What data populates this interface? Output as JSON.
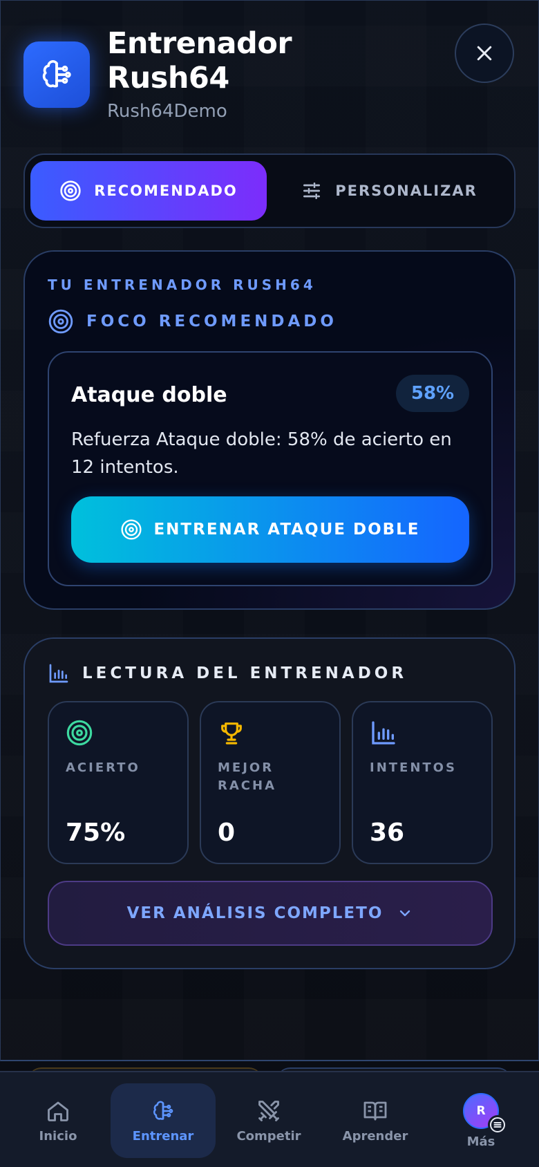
{
  "header": {
    "title_line1": "Entrenador",
    "title_line2": "Rush64",
    "subtitle": "Rush64Demo"
  },
  "icons": {
    "app": "brain-icon",
    "close": "close-icon",
    "recommended": "target-icon",
    "customize": "sliders-icon",
    "chart": "bar-chart-icon",
    "trophy": "trophy-icon",
    "chevron": "chevron-down-icon"
  },
  "tabs": [
    {
      "label": "RECOMENDADO",
      "active": true
    },
    {
      "label": "PERSONALIZAR",
      "active": false
    }
  ],
  "coach": {
    "eyebrow": "TU ENTRENADOR RUSH64",
    "focus_label": "FOCO RECOMENDADO",
    "focus": {
      "title": "Ataque doble",
      "percent": "58%",
      "description": "Refuerza Ataque doble: 58% de acierto en 12 intentos.",
      "button_label": "ENTRENAR ATAQUE DOBLE"
    }
  },
  "reading": {
    "title": "LECTURA DEL ENTRENADOR",
    "stats": [
      {
        "label": "ACIERTO",
        "value": "75%"
      },
      {
        "label": "MEJOR RACHA",
        "value": "0"
      },
      {
        "label": "INTENTOS",
        "value": "36"
      }
    ],
    "analysis_button": "VER ANÁLISIS COMPLETO"
  },
  "nav": {
    "items": [
      {
        "label": "Inicio",
        "active": false
      },
      {
        "label": "Entrenar",
        "active": true
      },
      {
        "label": "Competir",
        "active": false
      },
      {
        "label": "Aprender",
        "active": false
      },
      {
        "label": "Más",
        "active": false
      }
    ],
    "avatar_initial": "R"
  },
  "colors": {
    "accent_blue": "#2d6bff",
    "accent_purple": "#7c2dfb",
    "eyebrow_blue": "#6f9bff",
    "success_green": "#3dd9a0",
    "trophy_gold": "#f5b800"
  }
}
